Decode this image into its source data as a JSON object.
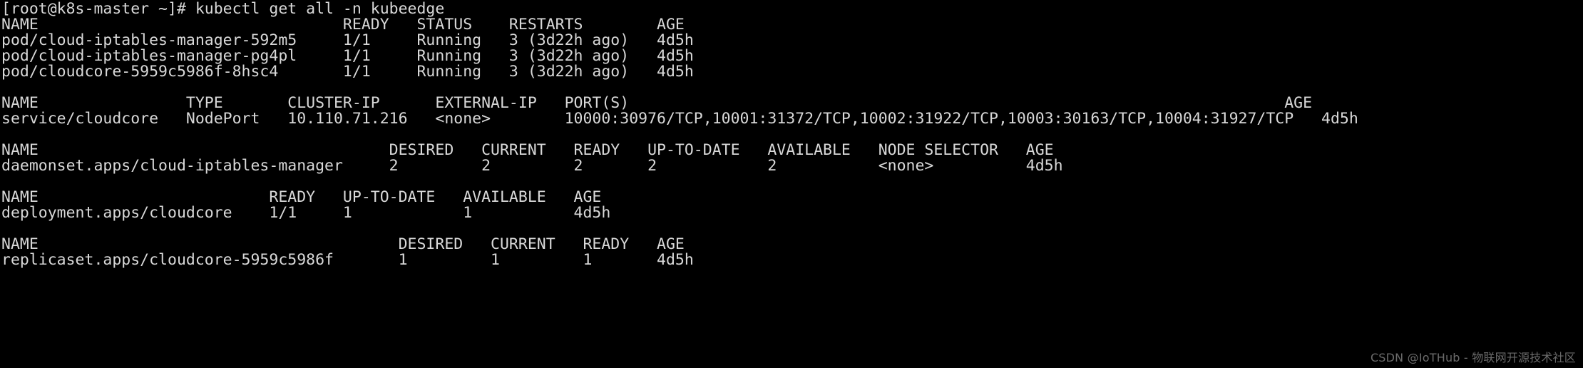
{
  "terminal": {
    "colors": {
      "background": "#000000",
      "foreground": "#d8d8d8",
      "watermark": "#6b6b6b"
    },
    "prompt": "[root@k8s-master ~]#",
    "command": "kubectl get all -n kubeedge",
    "prompt_line": "[root@k8s-master ~]# kubectl get all -n kubeedge",
    "lines": [
      "[root@k8s-master ~]# kubectl get all -n kubeedge",
      "NAME                                 READY   STATUS    RESTARTS        AGE",
      "pod/cloud-iptables-manager-592m5     1/1     Running   3 (3d22h ago)   4d5h",
      "pod/cloud-iptables-manager-pg4pl     1/1     Running   3 (3d22h ago)   4d5h",
      "pod/cloudcore-5959c5986f-8hsc4       1/1     Running   3 (3d22h ago)   4d5h",
      "",
      "NAME                TYPE       CLUSTER-IP      EXTERNAL-IP   PORT(S)                                                                       AGE",
      "service/cloudcore   NodePort   10.110.71.216   <none>        10000:30976/TCP,10001:31372/TCP,10002:31922/TCP,10003:30163/TCP,10004:31927/TCP   4d5h",
      "",
      "NAME                                      DESIRED   CURRENT   READY   UP-TO-DATE   AVAILABLE   NODE SELECTOR   AGE",
      "daemonset.apps/cloud-iptables-manager     2         2         2       2            2           <none>          4d5h",
      "",
      "NAME                         READY   UP-TO-DATE   AVAILABLE   AGE",
      "deployment.apps/cloudcore    1/1     1            1           4d5h",
      "",
      "NAME                                       DESIRED   CURRENT   READY   AGE",
      "replicaset.apps/cloudcore-5959c5986f       1         1         1       4d5h"
    ],
    "sections": [
      {
        "name": "pods",
        "headers": [
          "NAME",
          "READY",
          "STATUS",
          "RESTARTS",
          "AGE"
        ],
        "rows": [
          [
            "pod/cloud-iptables-manager-592m5",
            "1/1",
            "Running",
            "3 (3d22h ago)",
            "4d5h"
          ],
          [
            "pod/cloud-iptables-manager-pg4pl",
            "1/1",
            "Running",
            "3 (3d22h ago)",
            "4d5h"
          ],
          [
            "pod/cloudcore-5959c5986f-8hsc4",
            "1/1",
            "Running",
            "3 (3d22h ago)",
            "4d5h"
          ]
        ]
      },
      {
        "name": "services",
        "headers": [
          "NAME",
          "TYPE",
          "CLUSTER-IP",
          "EXTERNAL-IP",
          "PORT(S)",
          "AGE"
        ],
        "rows": [
          [
            "service/cloudcore",
            "NodePort",
            "10.110.71.216",
            "<none>",
            "10000:30976/TCP,10001:31372/TCP,10002:31922/TCP,10003:30163/TCP,10004:31927/TCP",
            "4d5h"
          ]
        ]
      },
      {
        "name": "daemonsets",
        "headers": [
          "NAME",
          "DESIRED",
          "CURRENT",
          "READY",
          "UP-TO-DATE",
          "AVAILABLE",
          "NODE SELECTOR",
          "AGE"
        ],
        "rows": [
          [
            "daemonset.apps/cloud-iptables-manager",
            "2",
            "2",
            "2",
            "2",
            "2",
            "<none>",
            "4d5h"
          ]
        ]
      },
      {
        "name": "deployments",
        "headers": [
          "NAME",
          "READY",
          "UP-TO-DATE",
          "AVAILABLE",
          "AGE"
        ],
        "rows": [
          [
            "deployment.apps/cloudcore",
            "1/1",
            "1",
            "1",
            "4d5h"
          ]
        ]
      },
      {
        "name": "replicasets",
        "headers": [
          "NAME",
          "DESIRED",
          "CURRENT",
          "READY",
          "AGE"
        ],
        "rows": [
          [
            "replicaset.apps/cloudcore-5959c5986f",
            "1",
            "1",
            "1",
            "4d5h"
          ]
        ]
      }
    ]
  },
  "watermark": {
    "text": "CSDN @IoTHub - 物联网开源技术社区"
  }
}
